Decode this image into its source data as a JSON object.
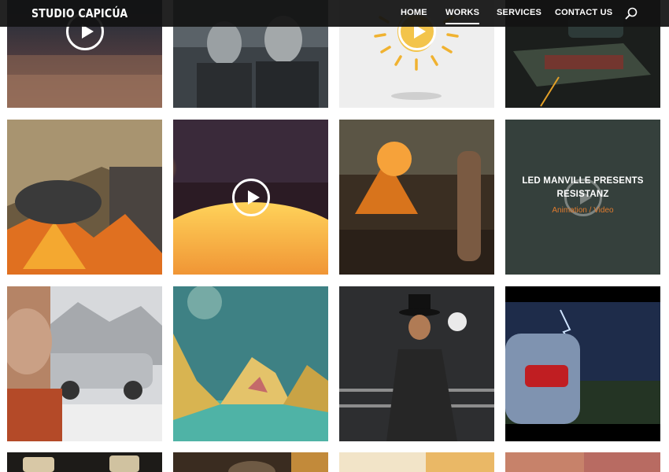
{
  "site": {
    "logo": "STUDIO CAPICÚA"
  },
  "nav": {
    "items": [
      {
        "label": "HOME"
      },
      {
        "label": "WORKS"
      },
      {
        "label": "SERVICES"
      },
      {
        "label": "CONTACT US"
      }
    ],
    "active": "WORKS",
    "search_icon": "search-icon"
  },
  "portfolio": {
    "hover_item": {
      "title_line1": "LED MANVILLE PRESENTS",
      "title_line2": "RESISTANZ",
      "category": "Animation / Video"
    }
  },
  "colors": {
    "header_bg": "#121212",
    "accent": "#e07b2e",
    "page_bg": "#ffffff"
  }
}
